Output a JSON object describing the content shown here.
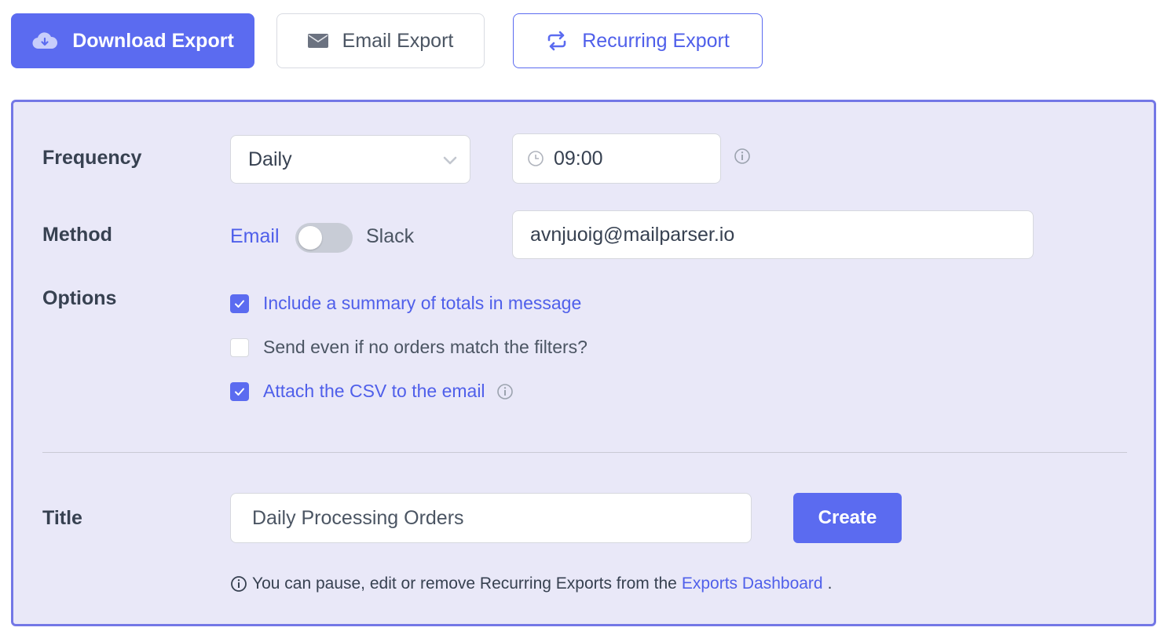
{
  "tabs": {
    "download": {
      "label": "Download Export",
      "icon": "cloud-download-icon"
    },
    "email": {
      "label": "Email Export",
      "icon": "envelope-icon"
    },
    "recurring": {
      "label": "Recurring Export",
      "icon": "repeat-icon"
    }
  },
  "form": {
    "frequency": {
      "label": "Frequency",
      "value": "Daily",
      "time": "09:00"
    },
    "method": {
      "label": "Method",
      "left_option": "Email",
      "right_option": "Slack",
      "toggle_on": false,
      "recipient": "avnjuoig@mailparser.io"
    },
    "options": {
      "label": "Options",
      "items": [
        {
          "label": "Include a summary of totals in message",
          "checked": true
        },
        {
          "label": "Send even if no orders match the filters?",
          "checked": false
        },
        {
          "label": "Attach the CSV to the email",
          "checked": true
        }
      ]
    },
    "title": {
      "label": "Title",
      "value": "Daily Processing Orders"
    },
    "create_label": "Create",
    "note": {
      "text": "You can pause, edit or remove Recurring Exports from the",
      "link": "Exports Dashboard",
      "end": "."
    }
  },
  "colors": {
    "accent": "#5b6bf0",
    "panel_bg": "#e9e8f8",
    "panel_border": "#7377e6"
  }
}
